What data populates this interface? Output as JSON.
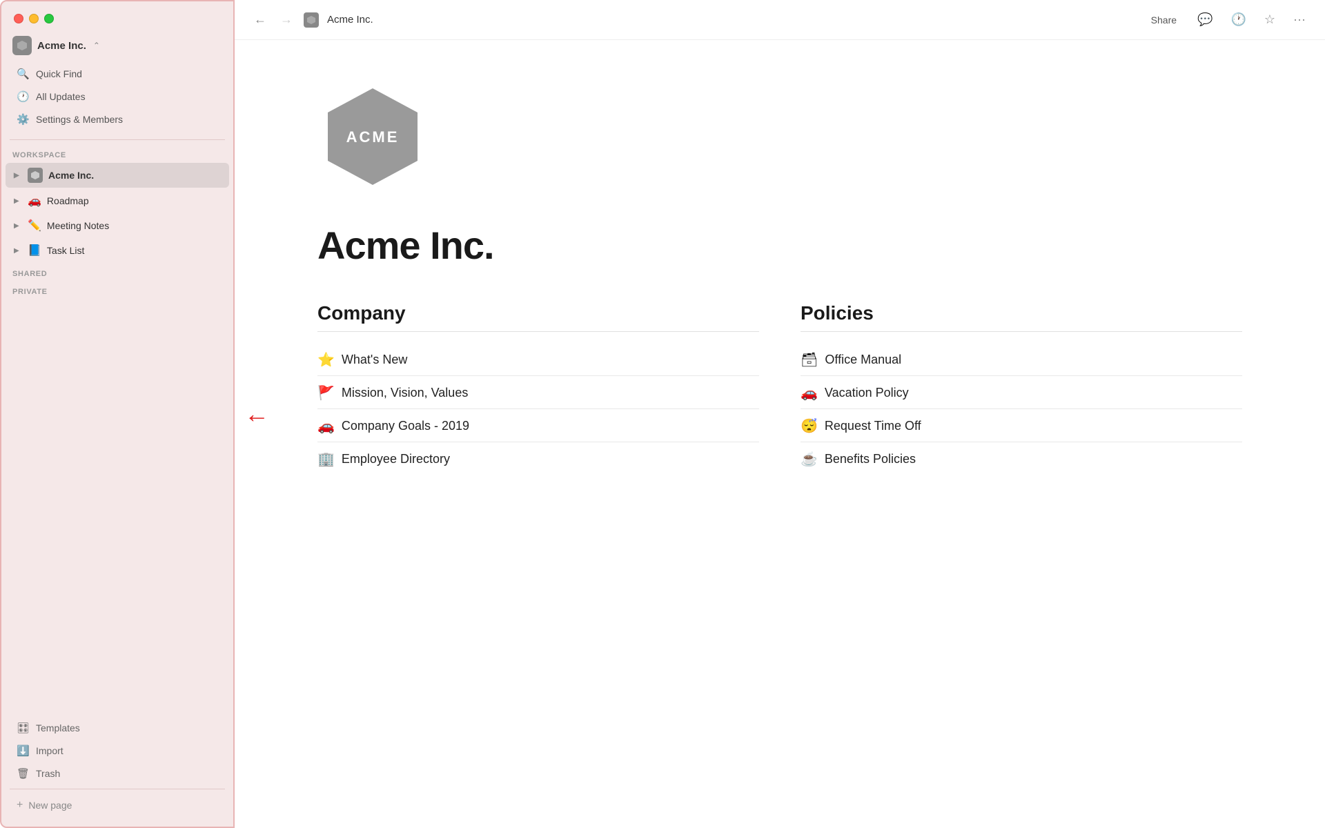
{
  "app": {
    "title": "Acme Inc.",
    "workspace_name": "Acme Inc."
  },
  "titlebar": {
    "page_title": "Acme Inc.",
    "share_label": "Share"
  },
  "sidebar": {
    "workspace_label": "WORKSPACE",
    "shared_label": "SHARED",
    "private_label": "PRIVATE",
    "nav_items": [
      {
        "id": "quick-find",
        "label": "Quick Find",
        "icon": "🔍"
      },
      {
        "id": "all-updates",
        "label": "All Updates",
        "icon": "🕐"
      },
      {
        "id": "settings",
        "label": "Settings & Members",
        "icon": "⚙️"
      }
    ],
    "workspace_items": [
      {
        "id": "acme-inc",
        "label": "Acme Inc.",
        "emoji": "",
        "active": true
      },
      {
        "id": "roadmap",
        "label": "Roadmap",
        "emoji": "🚗"
      },
      {
        "id": "meeting-notes",
        "label": "Meeting Notes",
        "emoji": "✏️"
      },
      {
        "id": "task-list",
        "label": "Task List",
        "emoji": "📘"
      }
    ],
    "bottom_items": [
      {
        "id": "templates",
        "label": "Templates",
        "icon": "🎛"
      },
      {
        "id": "import",
        "label": "Import",
        "icon": "⬇"
      },
      {
        "id": "trash",
        "label": "Trash",
        "icon": "🗑"
      }
    ],
    "new_page_label": "New page"
  },
  "page": {
    "heading": "Acme Inc.",
    "company_heading": "Company",
    "policies_heading": "Policies",
    "company_items": [
      {
        "emoji": "⭐",
        "text": "What's New"
      },
      {
        "emoji": "🚩",
        "text": "Mission, Vision, Values"
      },
      {
        "emoji": "🚗",
        "text": "Company Goals - 2019"
      },
      {
        "emoji": "🏢",
        "text": "Employee Directory"
      }
    ],
    "policies_items": [
      {
        "emoji": "🗃",
        "text": "Office Manual"
      },
      {
        "emoji": "🚗",
        "text": "Vacation Policy"
      },
      {
        "emoji": "😴",
        "text": "Request Time Off"
      },
      {
        "emoji": "☕",
        "text": "Benefits Policies"
      }
    ]
  }
}
